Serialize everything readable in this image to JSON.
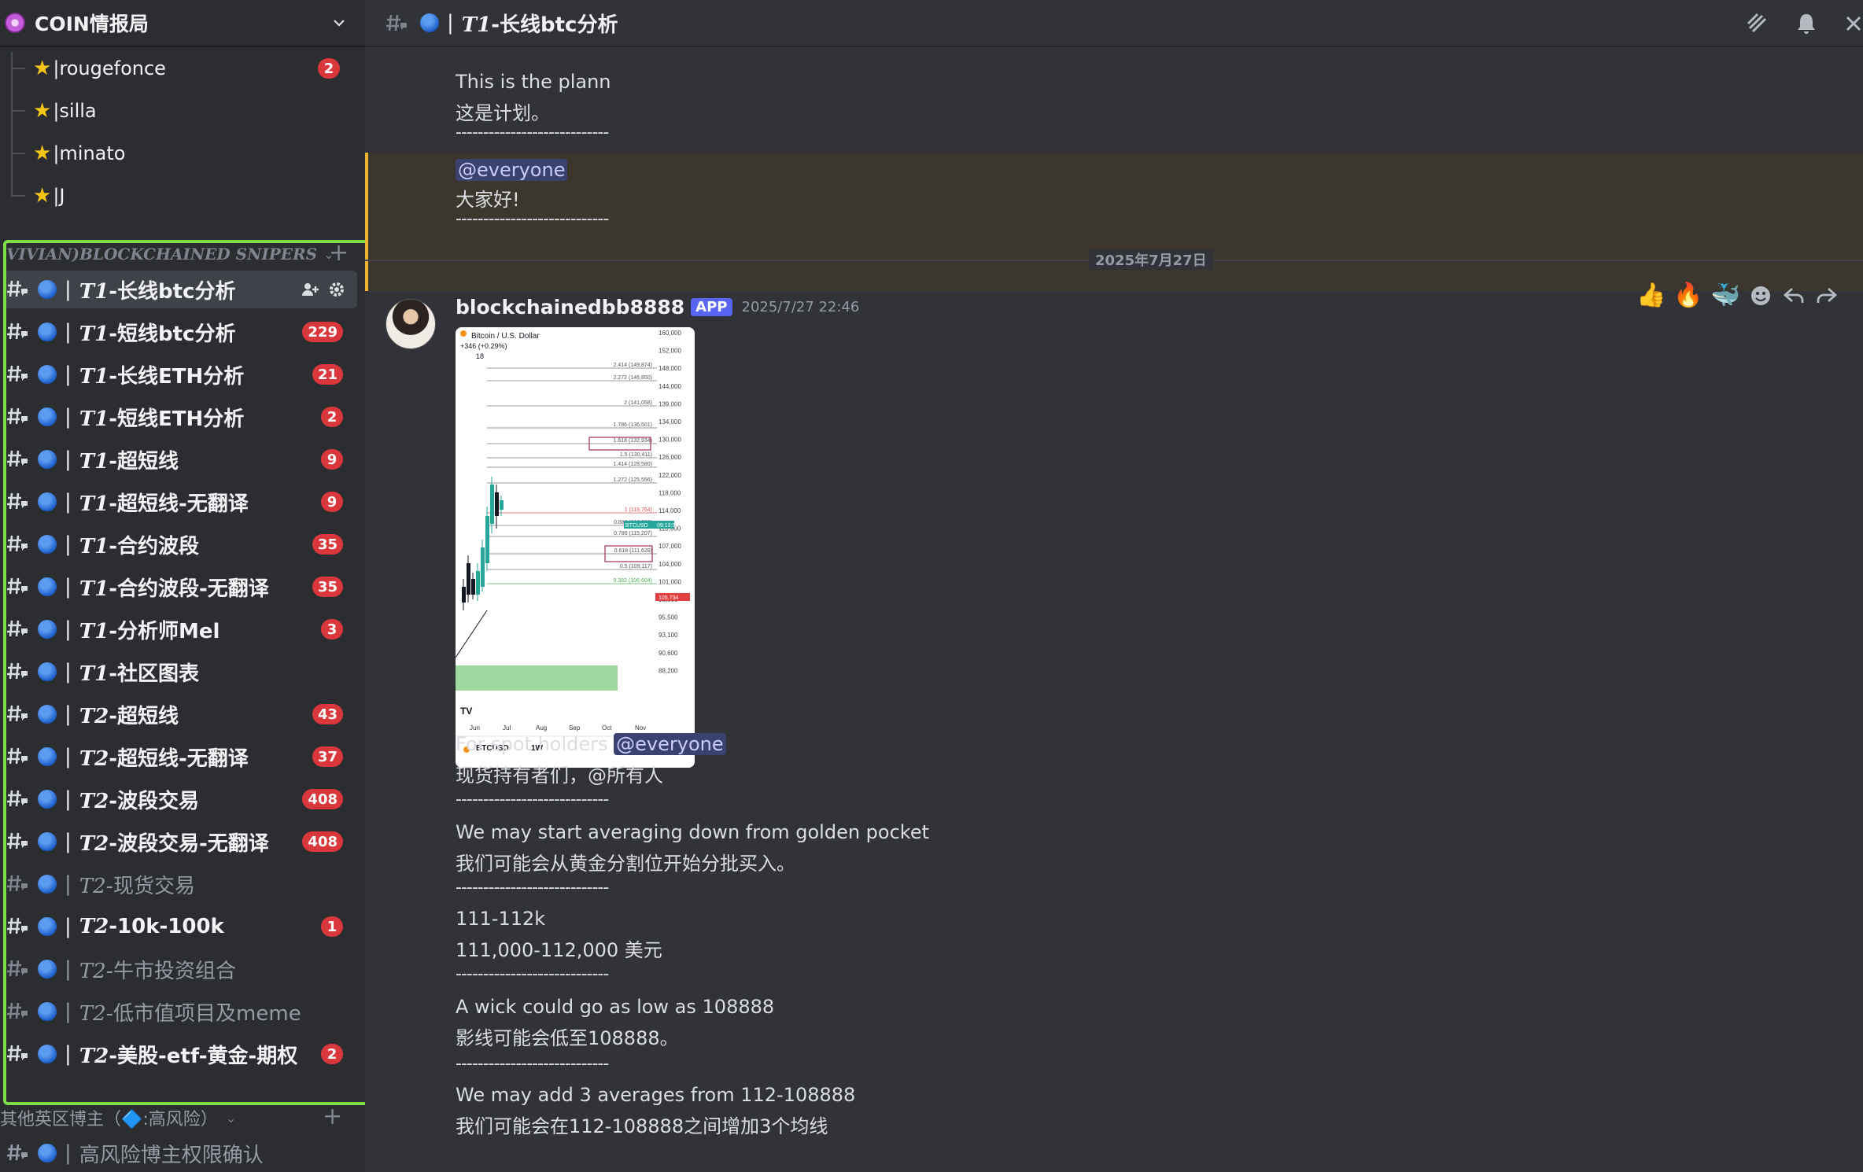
{
  "server": {
    "name": "COIN情报局"
  },
  "threads": [
    {
      "name": "|rougefonce",
      "badge": "2"
    },
    {
      "name": "|silla",
      "badge": ""
    },
    {
      "name": "|minato",
      "badge": ""
    },
    {
      "name": "|J",
      "badge": ""
    }
  ],
  "category": {
    "name": "VIVIAN)BLOCKCHAINED SNIPERS"
  },
  "channels": [
    {
      "prefix": "T1",
      "label": "-长线btc分析",
      "badge": "",
      "active": true,
      "muted": false
    },
    {
      "prefix": "T1",
      "label": "-短线btc分析",
      "badge": "229",
      "active": false,
      "muted": false
    },
    {
      "prefix": "T1",
      "label": "-长线ETH分析",
      "badge": "21",
      "active": false,
      "muted": false
    },
    {
      "prefix": "T1",
      "label": "-短线ETH分析",
      "badge": "2",
      "active": false,
      "muted": false
    },
    {
      "prefix": "T1",
      "label": "-超短线",
      "badge": "9",
      "active": false,
      "muted": false
    },
    {
      "prefix": "T1",
      "label": "-超短线-无翻译",
      "badge": "9",
      "active": false,
      "muted": false
    },
    {
      "prefix": "T1",
      "label": "-合约波段",
      "badge": "35",
      "active": false,
      "muted": false
    },
    {
      "prefix": "T1",
      "label": "-合约波段-无翻译",
      "badge": "35",
      "active": false,
      "muted": false
    },
    {
      "prefix": "T1",
      "label": "-分析师Mel",
      "badge": "3",
      "active": false,
      "muted": false
    },
    {
      "prefix": "T1",
      "label": "-社区图表",
      "badge": "",
      "active": false,
      "muted": false
    },
    {
      "prefix": "T2",
      "label": "-超短线",
      "badge": "43",
      "active": false,
      "muted": false
    },
    {
      "prefix": "T2",
      "label": "-超短线-无翻译",
      "badge": "37",
      "active": false,
      "muted": false
    },
    {
      "prefix": "T2",
      "label": "-波段交易",
      "badge": "408",
      "active": false,
      "muted": false
    },
    {
      "prefix": "T2",
      "label": "-波段交易-无翻译",
      "badge": "408",
      "active": false,
      "muted": false
    },
    {
      "prefix": "T2",
      "label": "-现货交易",
      "badge": "",
      "active": false,
      "muted": true
    },
    {
      "prefix": "T2",
      "label": "-10k-100k",
      "badge": "1",
      "active": false,
      "muted": false
    },
    {
      "prefix": "T2",
      "label": "-牛市投资组合",
      "badge": "",
      "active": false,
      "muted": true
    },
    {
      "prefix": "T2",
      "label": "-低市值项目及meme",
      "badge": "",
      "active": false,
      "muted": true
    },
    {
      "prefix": "T2",
      "label": "-美股-etf-黄金-期权",
      "badge": "2",
      "active": false,
      "muted": false
    }
  ],
  "category2": {
    "name": "其他英区博主（🔷:高风险）"
  },
  "extra_channel": {
    "label": "高风险博主权限确认"
  },
  "header": {
    "bar": "|",
    "title_prefix": "T1",
    "title_rest": "-长线btc分析"
  },
  "messages": {
    "prev": {
      "line1": "This is the plann",
      "line2": "这是计划。",
      "sep": "----------------------------",
      "mention": "@everyone",
      "greeting": "大家好!"
    },
    "date_divider": "2025年7月27日",
    "author": "blockchainedbb8888",
    "app_tag": "APP",
    "timestamp": "2025/7/27 22:46",
    "body": [
      {
        "text": "For spot holders ",
        "mention": "@everyone"
      },
      {
        "text": "现货持有者们，@所有人"
      },
      {
        "text": "----------------------------",
        "sep": true
      },
      {
        "text": "We may start averaging down from golden pocket"
      },
      {
        "text": "我们可能会从黄金分割位开始分批买入。"
      },
      {
        "text": "----------------------------",
        "sep": true
      },
      {
        "text": ""
      },
      {
        "text": "111-112k"
      },
      {
        "text": "111,000-112,000 美元"
      },
      {
        "text": "----------------------------",
        "sep": true
      },
      {
        "text": "A wick could go as low as 108888"
      },
      {
        "text": "影线可能会低至108888。"
      },
      {
        "text": "----------------------------",
        "sep": true
      },
      {
        "text": "We may add 3 averages from 112-108888"
      },
      {
        "text": "我们可能会在112-108888之间增加3个均线"
      }
    ]
  },
  "chart_image": {
    "symbol_title": "Bitcoin / U.S. Dollar",
    "change": "+346 (+0.29%)",
    "interval_ctrl": "18",
    "price_axis": [
      "160,000",
      "152,000",
      "148,000",
      "144,000",
      "139,000",
      "134,000",
      "130,000",
      "126,000",
      "122,000",
      "118,000",
      "114,000",
      "110,000",
      "107,000",
      "104,000",
      "101,000",
      "98,000",
      "95,500",
      "93,100",
      "90,600",
      "88,200"
    ],
    "fib_levels": [
      "2.414 (149,874)",
      "2.272 (146,850)",
      "2 (141,058)",
      "1.786 (136,501)",
      "1.618 (132,934)",
      "1.5 (130,411)",
      "1.414 (128,580)",
      "1.272 (125,556)",
      "1 (119,764)",
      "0.886 (117,336)",
      "0.786 (115,207)",
      "0.618 (111,628)",
      "0.5 (109,117)",
      "0.382 (106,604)"
    ],
    "price_tag_btc": "BTCUSD",
    "price_tag_time": "09:13:59",
    "price_tag_red": "105,734",
    "months": [
      "Jun",
      "Jul",
      "Aug",
      "Sep",
      "Oct",
      "Nov"
    ],
    "symbol": "BTCUSD",
    "interval": "1W",
    "logo": "TV"
  }
}
